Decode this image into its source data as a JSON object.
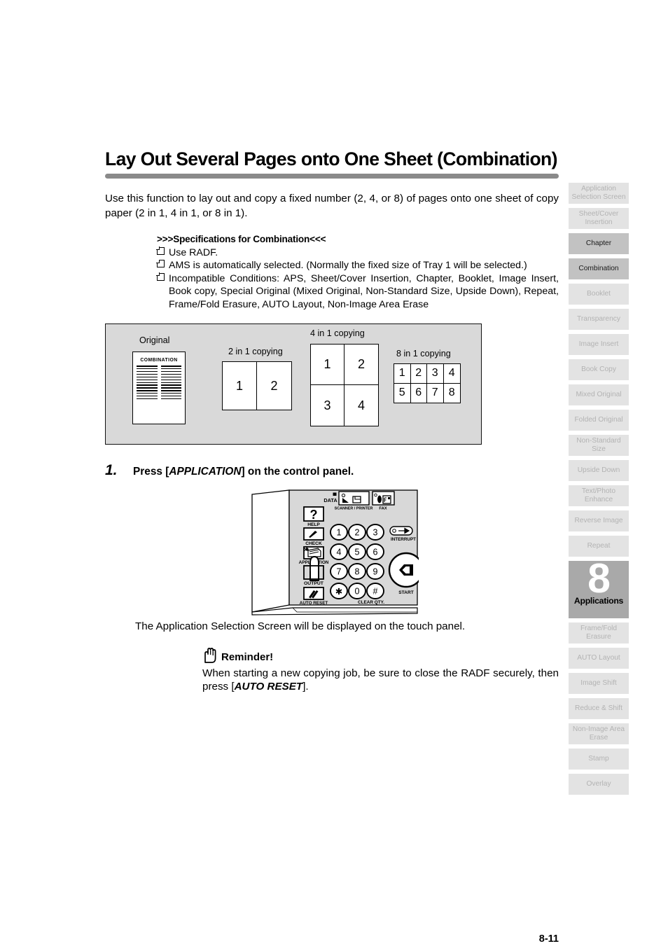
{
  "document": {
    "title": "Lay Out Several Pages onto One Sheet (Combination)",
    "intro": "Use this function to lay out and copy a fixed number (2, 4, or 8) of pages onto one sheet of copy paper (2 in 1, 4 in 1, or 8 in 1).",
    "page_number": "8-11"
  },
  "specifications": {
    "heading": ">>>Specifications for Combination<<<",
    "items": [
      "Use RADF.",
      "AMS is automatically selected. (Normally the fixed size of Tray 1 will be selected.)",
      "Incompatible Conditions: APS, Sheet/Cover Insertion, Chapter, Booklet, Image Insert, Book copy, Special Original (Mixed Original, Non-Standard Size, Upside Down), Repeat, Frame/Fold Erasure, AUTO Layout, Non-Image Area Erase"
    ]
  },
  "illustration": {
    "original_label": "Original",
    "original_sheet_title": "COMBINATION",
    "original_line_count": 13,
    "panels": [
      {
        "label": "2 in 1 copying",
        "cells": [
          "1",
          "2"
        ],
        "columns": 2,
        "rows": 1
      },
      {
        "label": "4 in 1 copying",
        "cells": [
          "1",
          "2",
          "3",
          "4"
        ],
        "columns": 2,
        "rows": 2
      },
      {
        "label": "8 in 1 copying",
        "cells": [
          "1",
          "2",
          "3",
          "4",
          "5",
          "6",
          "7",
          "8"
        ],
        "columns": 4,
        "rows": 2
      }
    ]
  },
  "step": {
    "number": "1.",
    "text_before": "Press [",
    "key_name": "APPLICATION",
    "text_after": "] on the control panel.",
    "followup": "The Application Selection Screen will be displayed on the touch panel."
  },
  "control_panel": {
    "data_label": "DATA",
    "scanner_printer_label": "SCANNER / PRINTER",
    "fax_label": "FAX",
    "help_label": "HELP",
    "check_label": "CHECK",
    "application_label": "APPLICATION",
    "output_label": "OUTPUT",
    "auto_reset_label": "AUTO RESET",
    "interrupt_label": "INTERRUPT",
    "start_label": "START",
    "clear_qty_label": "CLEAR QTY.",
    "keypad": [
      "1",
      "2",
      "3",
      "4",
      "5",
      "6",
      "7",
      "8",
      "9",
      "*",
      "0",
      "#"
    ],
    "help_glyph": "?"
  },
  "reminder": {
    "title": "Reminder!",
    "body_before": "When starting a new copying job, be sure to close the RADF securely, then press [",
    "key_name": "AUTO RESET",
    "body_after": "]."
  },
  "sidebar": {
    "tabs": [
      {
        "label": "Application Selection Screen",
        "active": false
      },
      {
        "label": "Sheet/Cover Insertion",
        "active": false
      },
      {
        "label": "Chapter",
        "active": true
      },
      {
        "label": "Combination",
        "active": true
      },
      {
        "label": "Booklet",
        "active": false
      },
      {
        "label": "Transparency",
        "active": false
      },
      {
        "label": "Image Insert",
        "active": false
      },
      {
        "label": "Book Copy",
        "active": false
      },
      {
        "label": "Mixed Original",
        "active": false
      },
      {
        "label": "Folded Original",
        "active": false
      },
      {
        "label": "Non-Standard Size",
        "active": false
      },
      {
        "label": "Upside Down",
        "active": false
      },
      {
        "label": "Text/Photo Enhance",
        "active": false
      },
      {
        "label": "Reverse Image",
        "active": false
      },
      {
        "label": "Repeat",
        "active": false
      }
    ],
    "chapter_marker": {
      "number": "8",
      "label": "Applications"
    },
    "tabs_after": [
      {
        "label": "Frame/Fold Erasure",
        "active": false
      },
      {
        "label": "AUTO Layout",
        "active": false
      },
      {
        "label": "Image Shift",
        "active": false
      },
      {
        "label": "Reduce & Shift",
        "active": false
      },
      {
        "label": "Non-Image Area Erase",
        "active": false
      },
      {
        "label": "Stamp",
        "active": false
      },
      {
        "label": "Overlay",
        "active": false
      }
    ]
  },
  "colors": {
    "title_rule": "#8a8a8a",
    "illustration_bg": "#d9d9d9",
    "tab_inactive_bg": "#e3e3e3",
    "tab_inactive_text": "#b3b3b3",
    "tab_active_bg": "#c2c2c2",
    "chapter_marker_bg": "#a9a9a9"
  }
}
